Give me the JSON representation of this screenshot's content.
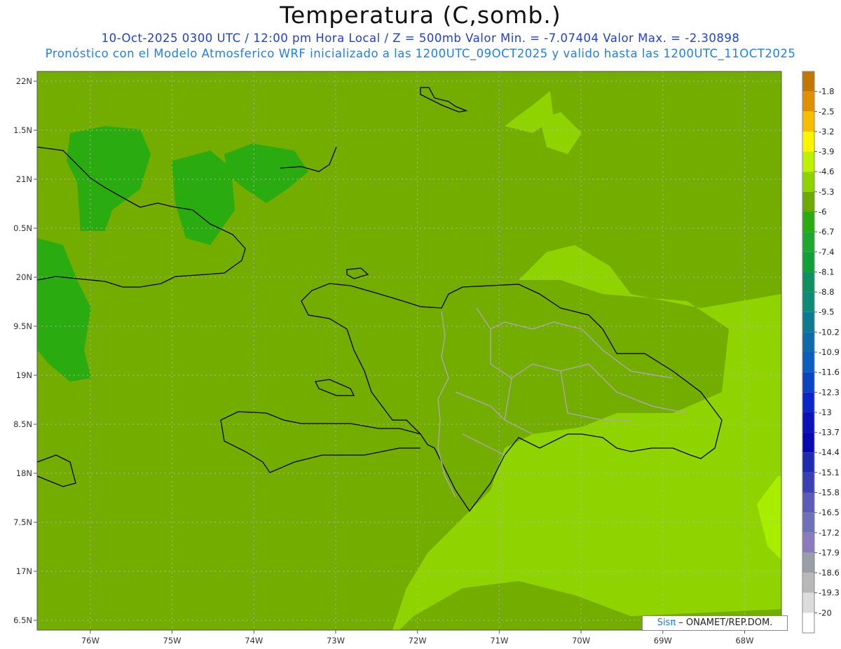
{
  "header": {
    "title": "Temperatura (C,somb.)",
    "line1": "10-Oct-2025  0300 UTC / 12:00 pm Hora Local / Z = 500mb  Valor Min. = -7.07404  Valor Max. = -2.30898",
    "line2": "Pronóstico con el Modelo Atmosferico WRF inicializado a las 1200UTC_09OCT2025 y valido hasta las  1200UTC_11OCT2025"
  },
  "axes": {
    "lon_labels": [
      "76W",
      "75W",
      "74W",
      "73W",
      "72W",
      "71W",
      "70W",
      "69W",
      "68W"
    ],
    "lon_values": [
      -76,
      -75,
      -74,
      -73,
      -72,
      -71,
      -70,
      -69,
      -68
    ],
    "lat_labels": [
      "22N",
      "1.5N",
      "21N",
      "0.5N",
      "20N",
      "9.5N",
      "19N",
      "8.5N",
      "18N",
      "7.5N",
      "17N",
      "6.5N"
    ],
    "lat_values": [
      22,
      21.5,
      21,
      20.5,
      20,
      19.5,
      19,
      18.5,
      18,
      17.5,
      17,
      16.5
    ],
    "lon_range": [
      -76.65,
      -67.55
    ],
    "lat_range": [
      16.4,
      22.1
    ],
    "grid": true
  },
  "legend": {
    "labels": [
      "-1.8",
      "-2.5",
      "-3.2",
      "-3.9",
      "-4.6",
      "-5.3",
      "-6",
      "-6.7",
      "-7.4",
      "-8.1",
      "-8.8",
      "-9.5",
      "-10.2",
      "-10.9",
      "-11.6",
      "-12.3",
      "-13",
      "-13.7",
      "-14.4",
      "-15.1",
      "-15.8",
      "-16.5",
      "-17.2",
      "-17.9",
      "-18.6",
      "-19.3",
      "-20"
    ],
    "colors": [
      "#c07800",
      "#e09000",
      "#f5be00",
      "#fdf400",
      "#bef000",
      "#8fd400",
      "#6caa00",
      "#2aab10",
      "#1ea830",
      "#11a038",
      "#109060",
      "#0e8a78",
      "#0c7a90",
      "#0d6ca8",
      "#0d5cc0",
      "#0a45c0",
      "#0a25c8",
      "#0a12b8",
      "#0808b0",
      "#1e2ab0",
      "#3a40b4",
      "#5a5cb6",
      "#6e70b8",
      "#8a7cbc",
      "#9a9ea6",
      "#b8b8b8",
      "#dcdcdc",
      "#ffffff"
    ]
  },
  "map": {
    "background_color": "#72ad00",
    "light_color": "#8fd400",
    "lighter_color": "#a8ec00",
    "dark_color": "#2aab10"
  },
  "credit": {
    "brand": "Sisπ",
    "text": " – ONAMET/REP.DOM."
  }
}
